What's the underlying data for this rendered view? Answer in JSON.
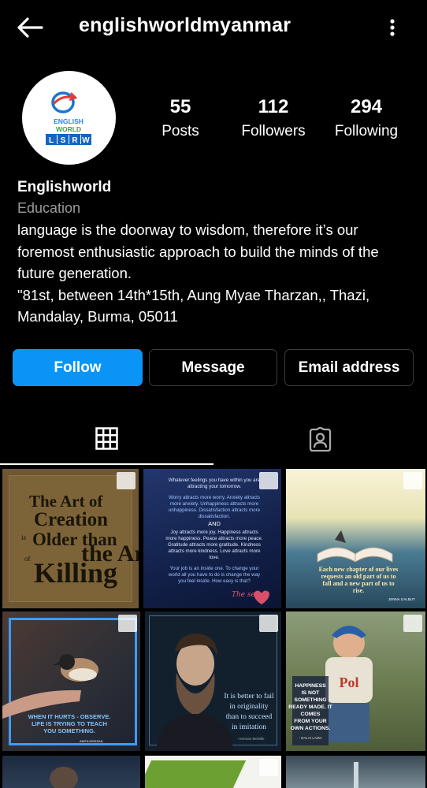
{
  "header": {
    "username": "englishworldmyanmar",
    "back_icon": "arrow-left-icon",
    "more_icon": "more-vertical-icon"
  },
  "avatar": {
    "line1": "ENGLISH",
    "line2": "WORLD",
    "letters": [
      "L",
      "S",
      "R",
      "W"
    ]
  },
  "stats": [
    {
      "value": "55",
      "label": "Posts"
    },
    {
      "value": "112",
      "label": "Followers"
    },
    {
      "value": "294",
      "label": "Following"
    }
  ],
  "bio": {
    "name": "Englishworld",
    "category": "Education",
    "line1": "language is the doorway to wisdom, therefore it’s our",
    "line2": "foremost enthusiastic approach to build the minds of the",
    "line3": "future generation.",
    "line4": "\"81st, between 14th*15th, Aung Myae Tharzan,, Thazi,",
    "line5": "Mandalay, Burma, 05011"
  },
  "buttons": {
    "follow": "Follow",
    "message": "Message",
    "email": "Email address"
  },
  "colors": {
    "accent": "#0a95f6",
    "muted": "#9a9a9a"
  },
  "posts": {
    "p1": {
      "line1": "The Art of",
      "line2": "Creation",
      "line3": "is",
      "line4": "Older than",
      "line5": "the Art",
      "line6": "of",
      "line7": "Killing"
    },
    "p2": {
      "l1": "Whatever feelings you have within you are",
      "l2": "attracting your tomorrow.",
      "l3": "Worry attracts more worry. Anxiety attracts",
      "l4": "more anxiety. Unhappiness attracts more",
      "l5": "unhappiness. Dissatisfaction attracts more",
      "l6": "dissatisfaction.",
      "l7": "AND",
      "l8": "Joy attracts more joy. Happiness attracts",
      "l9": "more happiness. Peace attracts more peace.",
      "l10": "Gratitude attracts more gratitude. Kindness",
      "l11": "attracts more kindness. Love attracts more",
      "l12": "love.",
      "l13": "Your job is an inside one. To change your",
      "l14": "world all you have to do is change the way",
      "l15": "you feel inside. How easy is that?",
      "l16": "The secret"
    },
    "p3": {
      "l1": "Each new chapter of our lives",
      "l2": "requests an old part of us to",
      "l3": "fall and a new part of us to",
      "l4": "rise.",
      "author": "JENNA GALBUT"
    },
    "p4": {
      "l1": "WHEN IT HURTS - OBSERVE.",
      "l2": "LIFE IS TRYING TO TEACH",
      "l3": "YOU SOMETHING.",
      "author": "ANITA KRIZZAN"
    },
    "p5": {
      "l1": "It is better to fail",
      "l2": "in originality",
      "l3": "than to succeed",
      "l4": "in imitation",
      "author": "- Herman Melville"
    },
    "p6": {
      "l1": "HAPPINESS",
      "l2": "IS NOT",
      "l3": "SOMETHING",
      "l4": "READY MADE. IT",
      "l5": "COMES",
      "l6": "FROM YOUR",
      "l7": "OWN ACTIONS.",
      "author": "- DALAI LAMA",
      "shirt": "Pol"
    }
  }
}
